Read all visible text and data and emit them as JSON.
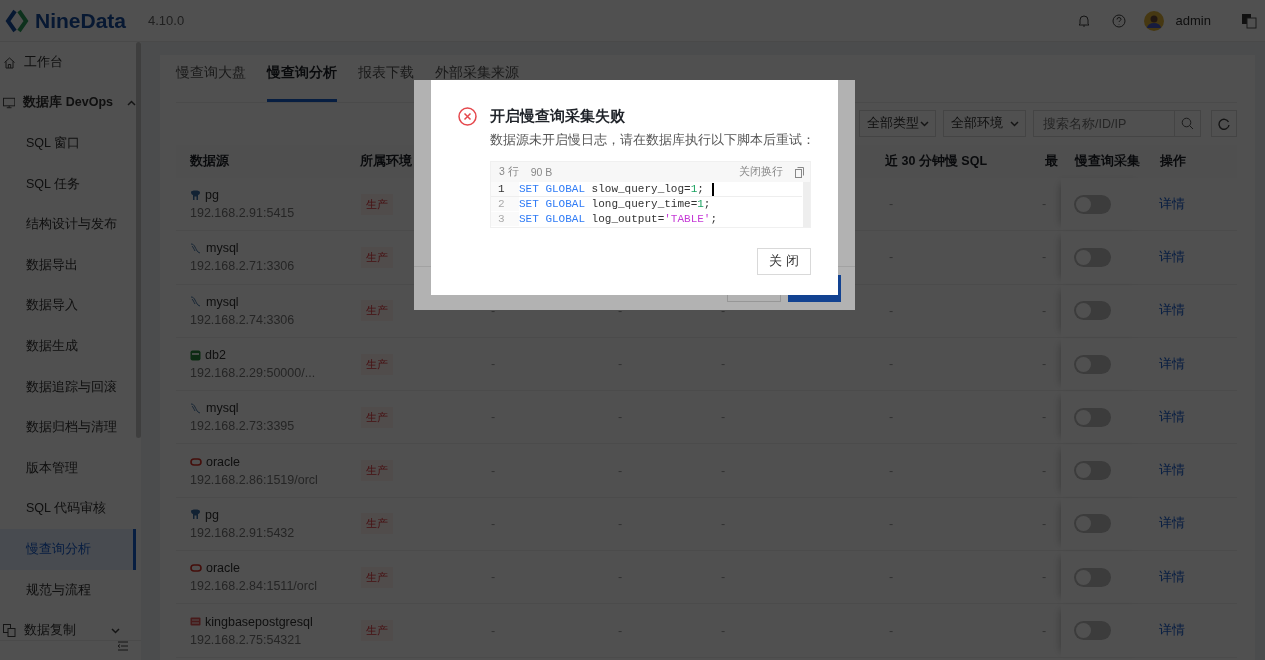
{
  "header": {
    "brand": "NineData",
    "version": "4.10.0",
    "user": "admin"
  },
  "sidebar": {
    "items": [
      {
        "label": "工作台",
        "kind": "home",
        "selected": false
      },
      {
        "label": "数据库 DevOps",
        "kind": "devops",
        "expanded": true,
        "selected": false,
        "children": [
          {
            "label": "SQL 窗口",
            "selected": false
          },
          {
            "label": "SQL 任务",
            "selected": false
          },
          {
            "label": "结构设计与发布",
            "selected": false
          },
          {
            "label": "数据导出",
            "selected": false
          },
          {
            "label": "数据导入",
            "selected": false
          },
          {
            "label": "数据生成",
            "selected": false
          },
          {
            "label": "数据追踪与回滚",
            "selected": false
          },
          {
            "label": "数据归档与清理",
            "selected": false
          },
          {
            "label": "版本管理",
            "selected": false
          },
          {
            "label": "SQL 代码审核",
            "selected": false
          },
          {
            "label": "慢查询分析",
            "selected": true
          },
          {
            "label": "规范与流程",
            "selected": false
          }
        ]
      },
      {
        "label": "数据复制",
        "kind": "replication",
        "expanded": false,
        "selected": false
      }
    ]
  },
  "tabs": [
    {
      "label": "慢查询大盘",
      "selected": false
    },
    {
      "label": "慢查询分析",
      "selected": true
    },
    {
      "label": "报表下载",
      "selected": false
    },
    {
      "label": "外部采集来源",
      "selected": false
    }
  ],
  "filters": {
    "type": "全部类型",
    "env": "全部环境",
    "search_placeholder": "搜索名称/ID/IP"
  },
  "table": {
    "columns": [
      "数据源",
      "所属环境",
      "近 30 分钟慢 SQL",
      "最",
      "慢查询采集",
      "操作"
    ],
    "rows": [
      {
        "kind": "pg",
        "name": "pg",
        "address": "192.168.2.91:5415",
        "env": "生产",
        "recent": "-",
        "last": "-",
        "on": false,
        "action": "详情"
      },
      {
        "kind": "mysql",
        "name": "mysql",
        "address": "192.168.2.71:3306",
        "env": "生产",
        "recent": "-",
        "last": "-",
        "on": false,
        "action": "详情"
      },
      {
        "kind": "mysql",
        "name": "mysql",
        "address": "192.168.2.74:3306",
        "env": "生产",
        "cells": [
          "-",
          "-",
          "-"
        ],
        "recent": "-",
        "last": "-",
        "on": false,
        "action": "详情"
      },
      {
        "kind": "db2",
        "name": "db2",
        "address": "192.168.2.29:50000/...",
        "env": "生产",
        "cells": [
          "-",
          "-",
          "-"
        ],
        "recent": "-",
        "last": "-",
        "on": false,
        "action": "详情"
      },
      {
        "kind": "mysql",
        "name": "mysql",
        "address": "192.168.2.73:3395",
        "env": "生产",
        "cells": [
          "-",
          "-",
          "-"
        ],
        "recent": "-",
        "last": "-",
        "on": false,
        "action": "详情"
      },
      {
        "kind": "oracle",
        "name": "oracle",
        "address": "192.168.2.86:1519/orcl",
        "env": "生产",
        "cells": [
          "-",
          "-",
          "-"
        ],
        "recent": "-",
        "last": "-",
        "on": false,
        "action": "详情"
      },
      {
        "kind": "pg",
        "name": "pg",
        "address": "192.168.2.91:5432",
        "env": "生产",
        "cells": [
          "-",
          "-",
          "-"
        ],
        "recent": "-",
        "last": "-",
        "on": false,
        "action": "详情"
      },
      {
        "kind": "oracle",
        "name": "oracle",
        "address": "192.168.2.84:1511/orcl",
        "env": "生产",
        "cells": [
          "-",
          "-",
          "-"
        ],
        "recent": "-",
        "last": "-",
        "on": false,
        "action": "详情"
      },
      {
        "kind": "kingbase",
        "name": "kingbasepostgresql",
        "address": "192.168.2.75:54321",
        "env": "生产",
        "cells": [
          "-",
          "-",
          "-"
        ],
        "recent": "-",
        "last": "-",
        "on": false,
        "action": "详情"
      }
    ]
  },
  "dialog": {
    "title": "开启慢查询采集失败",
    "message": "数据源未开启慢日志，请在数据库执行以下脚本后重试：",
    "code": {
      "line_count": "3 行",
      "size": "90 B",
      "wrap_toggle": "关闭换行",
      "lines": [
        {
          "number": "1",
          "active": true,
          "tokens": [
            {
              "text": "SET GLOBAL",
              "kind": "keyword"
            },
            {
              "text": " slow_query_log=",
              "kind": "plain"
            },
            {
              "text": "1",
              "kind": "number"
            },
            {
              "text": ";",
              "kind": "plain"
            }
          ]
        },
        {
          "number": "2",
          "active": false,
          "tokens": [
            {
              "text": "SET GLOBAL",
              "kind": "keyword"
            },
            {
              "text": " long_query_time=",
              "kind": "plain"
            },
            {
              "text": "1",
              "kind": "number"
            },
            {
              "text": ";",
              "kind": "plain"
            }
          ]
        },
        {
          "number": "3",
          "active": false,
          "tokens": [
            {
              "text": "SET GLOBAL",
              "kind": "keyword"
            },
            {
              "text": " log_output=",
              "kind": "plain"
            },
            {
              "text": "'TABLE'",
              "kind": "string"
            },
            {
              "text": ";",
              "kind": "plain"
            }
          ]
        }
      ]
    },
    "button": "关 闭"
  }
}
